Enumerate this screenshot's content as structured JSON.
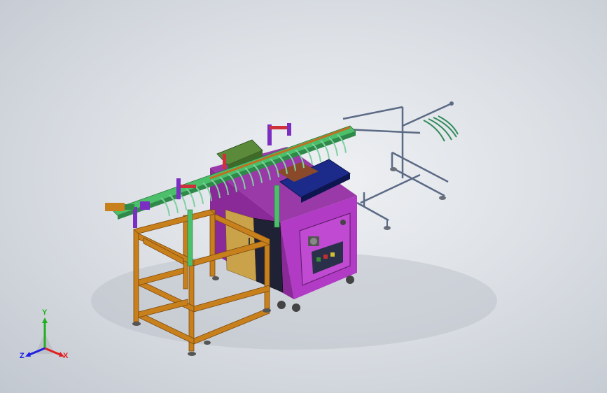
{
  "viewport": {
    "background_top": "#eef0f3",
    "background_bottom": "#c2c8d0"
  },
  "model": {
    "colors": {
      "frame_orange": "#c8801c",
      "frame_orange_dark": "#8a5310",
      "cabinet_magenta": "#b13bc4",
      "cabinet_magenta_dark": "#7a2288",
      "cabinet_panel_dark": "#2a2f4a",
      "door_yellow": "#c9a24a",
      "conveyor_green": "#4bbf6a",
      "conveyor_teal": "#7fd0a0",
      "cover_blue": "#1c2a8a",
      "rack_steel": "#5b6a85",
      "cylinder_purple": "#7a2fc2",
      "accent_red": "#d0303a",
      "accent_brown": "#8a4a2a",
      "hopper_green": "#5a8a3a"
    }
  },
  "triad": {
    "x_label": "X",
    "y_label": "Y",
    "z_label": "Z",
    "x_color": "#e02020",
    "y_color": "#20b020",
    "z_color": "#2020e0"
  }
}
